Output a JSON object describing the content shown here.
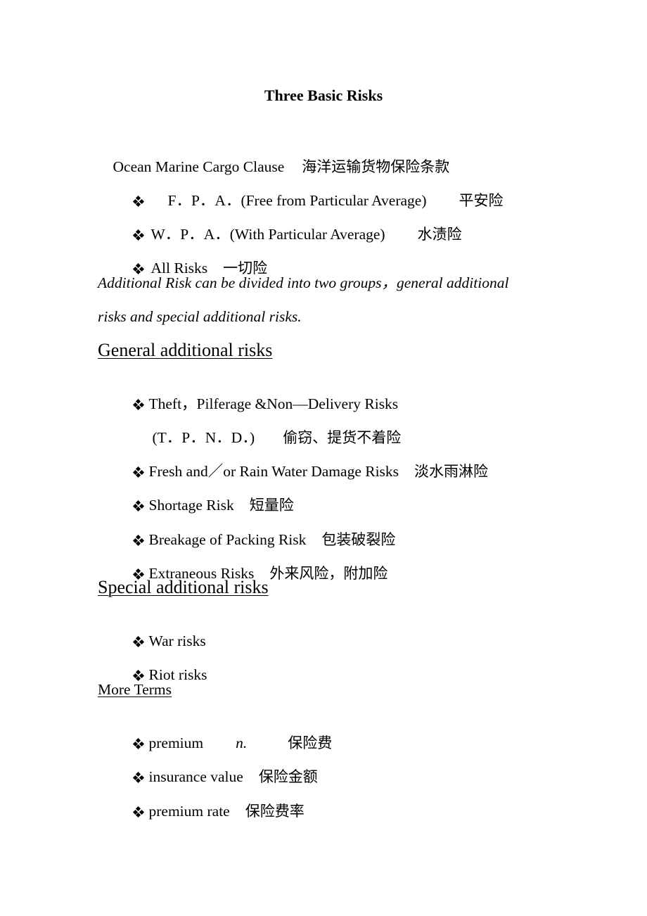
{
  "document": {
    "title": "Three Basic Risks",
    "intro": {
      "en": "Ocean Marine Cargo Clause",
      "cn": "海洋运输货物保险条款"
    },
    "basic_risks": [
      {
        "en": "F．P．A．(Free from Particular Average)",
        "cn": "平安险"
      },
      {
        "en": "W．P．A．(With Particular Average)",
        "cn": "水渍险"
      },
      {
        "en": "All Risks",
        "cn": "一切险"
      }
    ],
    "additional_note": {
      "line1": "Additional Risk can be divided into two groups，general additional",
      "line2": "risks and special additional risks."
    },
    "general_section": {
      "heading": "General additional risks",
      "items": [
        {
          "en": "Theft，Pilferage &Non—Delivery Risks",
          "cn": ""
        },
        {
          "en": "(T．P．N．D．)",
          "cn": "偷窃、提货不着险",
          "continuation": true
        },
        {
          "en": "Fresh and／or Rain Water Damage Risks",
          "cn": "淡水雨淋险"
        },
        {
          "en": "Shortage Risk",
          "cn": "短量险"
        },
        {
          "en": "Breakage of Packing Risk",
          "cn": "包装破裂险"
        },
        {
          "en": "Extraneous Risks",
          "cn": "外来风险，附加险"
        }
      ]
    },
    "special_section": {
      "heading": "Special additional risks",
      "items": [
        {
          "en": "War risks"
        },
        {
          "en": "Riot risks"
        }
      ]
    },
    "more_terms": {
      "heading": "More Terms",
      "items": [
        {
          "en": "premium",
          "pos": "n.",
          "cn": "保险费"
        },
        {
          "en": "insurance value",
          "cn": "保险金额"
        },
        {
          "en": "premium rate",
          "cn": "保险费率"
        }
      ]
    },
    "bullet_icon": "diamond-cluster-bullet"
  }
}
